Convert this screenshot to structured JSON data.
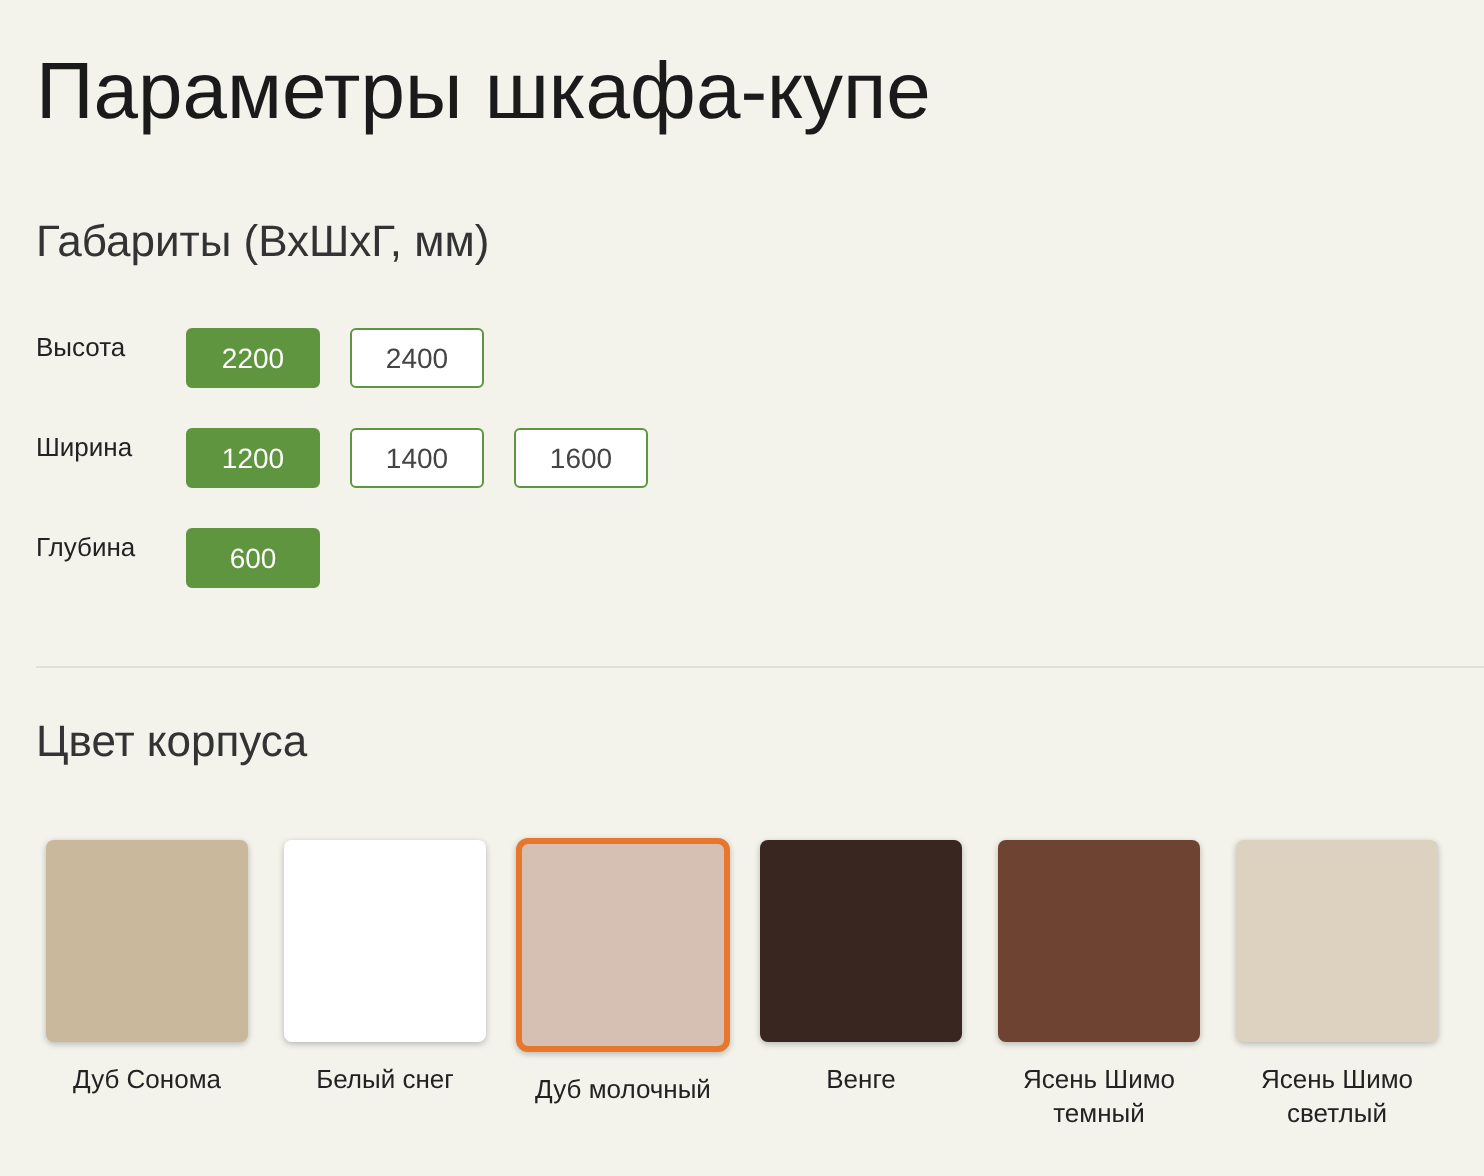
{
  "title": "Параметры шкафа-купе",
  "dimensions": {
    "heading": "Габариты (ВхШхГ, мм)",
    "rows": [
      {
        "label": "Высота",
        "options": [
          {
            "value": "2200",
            "selected": true
          },
          {
            "value": "2400",
            "selected": false
          }
        ]
      },
      {
        "label": "Ширина",
        "options": [
          {
            "value": "1200",
            "selected": true
          },
          {
            "value": "1400",
            "selected": false
          },
          {
            "value": "1600",
            "selected": false
          }
        ]
      },
      {
        "label": "Глубина",
        "options": [
          {
            "value": "600",
            "selected": true
          }
        ]
      }
    ]
  },
  "body_color": {
    "heading": "Цвет корпуса",
    "swatches": [
      {
        "name": "Дуб Сонома",
        "color": "#c9b89c",
        "selected": false
      },
      {
        "name": "Белый снег",
        "color": "#ffffff",
        "selected": false
      },
      {
        "name": "Дуб молочный",
        "color": "#d6c0b3",
        "selected": true
      },
      {
        "name": "Венге",
        "color": "#3a2620",
        "selected": false
      },
      {
        "name": "Ясень Шимо темный",
        "color": "#6e4331",
        "selected": false
      },
      {
        "name": "Ясень Шимо светлый",
        "color": "#ddd1bf",
        "selected": false
      }
    ]
  }
}
